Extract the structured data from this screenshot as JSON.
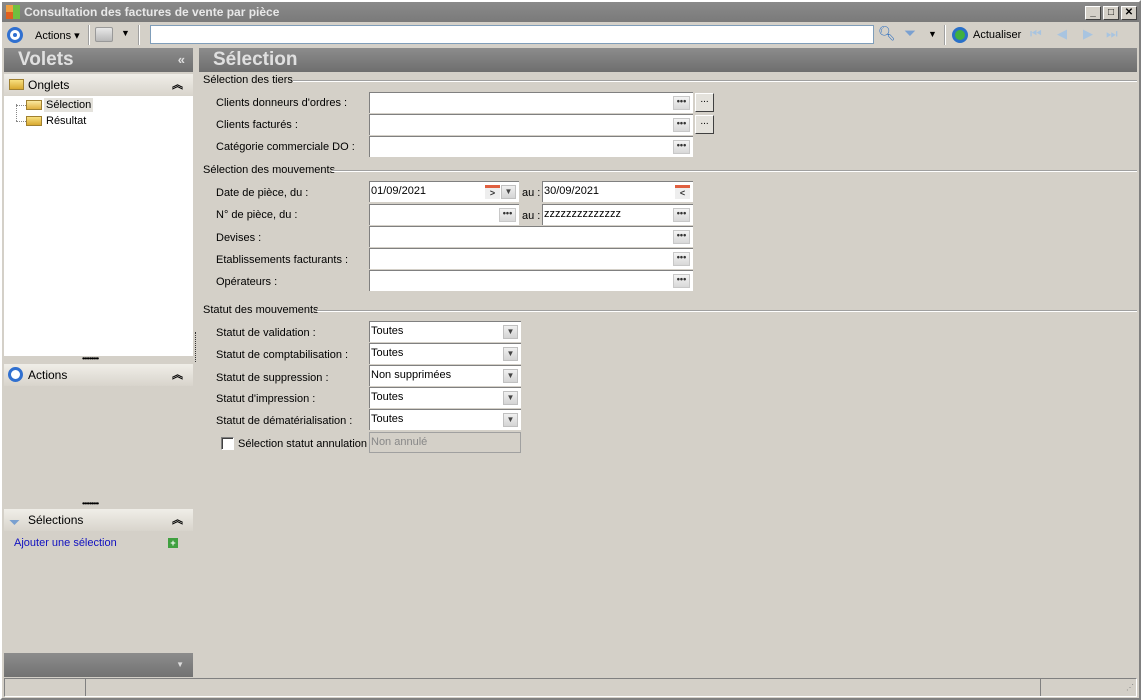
{
  "window": {
    "title": "Consultation des factures de vente par pièce"
  },
  "toolbar": {
    "actions_label": "Actions",
    "search_value": "",
    "refresh_label": "Actualiser"
  },
  "left": {
    "title": "Volets",
    "onglets": "Onglets",
    "tree": [
      "Sélection",
      "Résultat"
    ],
    "actions": "Actions",
    "selections": "Sélections",
    "add_selection": "Ajouter une sélection"
  },
  "main": {
    "title": "Sélection",
    "tiers": {
      "title": "Sélection des tiers",
      "fields": [
        {
          "label": "Clients donneurs d'ordres :",
          "value": ""
        },
        {
          "label": "Clients facturés :",
          "value": ""
        },
        {
          "label": "Catégorie commerciale DO :",
          "value": ""
        }
      ]
    },
    "mouvements": {
      "title": "Sélection des mouvements",
      "date_label": "Date de pièce, du :",
      "date_from": "01/09/2021",
      "date_to": "30/09/2021",
      "au": "au :",
      "piece_label": "N° de pièce, du :",
      "piece_from": "",
      "piece_to": "zzzzzzzzzzzzzz",
      "fields": [
        {
          "label": "Devises :",
          "value": ""
        },
        {
          "label": "Etablissements facturants :",
          "value": ""
        },
        {
          "label": "Opérateurs :",
          "value": ""
        }
      ]
    },
    "statut": {
      "title": "Statut des mouvements",
      "selects": [
        {
          "label": "Statut de validation :",
          "value": "Toutes"
        },
        {
          "label": "Statut de comptabilisation :",
          "value": "Toutes"
        },
        {
          "label": "Statut de suppression :",
          "value": "Non supprimées"
        },
        {
          "label": "Statut d'impression :",
          "value": "Toutes"
        },
        {
          "label": "Statut de dématérialisation :",
          "value": "Toutes"
        }
      ],
      "annulation_label": "Sélection statut annulation",
      "annulation_checked": false,
      "annulation_value": "Non annulé"
    }
  }
}
